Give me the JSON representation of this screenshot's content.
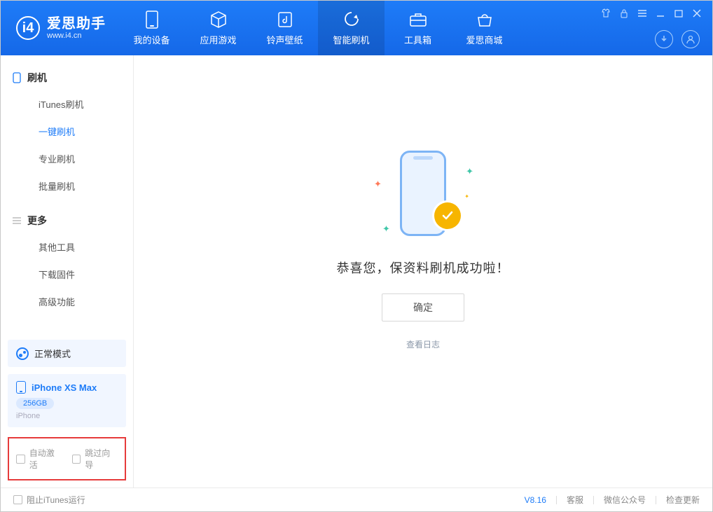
{
  "header": {
    "appTitle": "爱思助手",
    "appUrl": "www.i4.cn",
    "tabs": [
      {
        "label": "我的设备"
      },
      {
        "label": "应用游戏"
      },
      {
        "label": "铃声壁纸"
      },
      {
        "label": "智能刷机"
      },
      {
        "label": "工具箱"
      },
      {
        "label": "爱思商城"
      }
    ]
  },
  "sidebar": {
    "group1": {
      "title": "刷机"
    },
    "items1": [
      {
        "label": "iTunes刷机"
      },
      {
        "label": "一键刷机"
      },
      {
        "label": "专业刷机"
      },
      {
        "label": "批量刷机"
      }
    ],
    "group2": {
      "title": "更多"
    },
    "items2": [
      {
        "label": "其他工具"
      },
      {
        "label": "下载固件"
      },
      {
        "label": "高级功能"
      }
    ],
    "status": "正常模式",
    "device": {
      "name": "iPhone XS Max",
      "capacity": "256GB",
      "type": "iPhone"
    },
    "options": {
      "autoActivate": "自动激活",
      "skipGuide": "跳过向导"
    }
  },
  "main": {
    "successMsg": "恭喜您，保资料刷机成功啦！",
    "okButton": "确定",
    "viewLog": "查看日志"
  },
  "footer": {
    "blockItunes": "阻止iTunes运行",
    "version": "V8.16",
    "links": {
      "support": "客服",
      "wechat": "微信公众号",
      "checkUpdate": "检查更新"
    }
  }
}
